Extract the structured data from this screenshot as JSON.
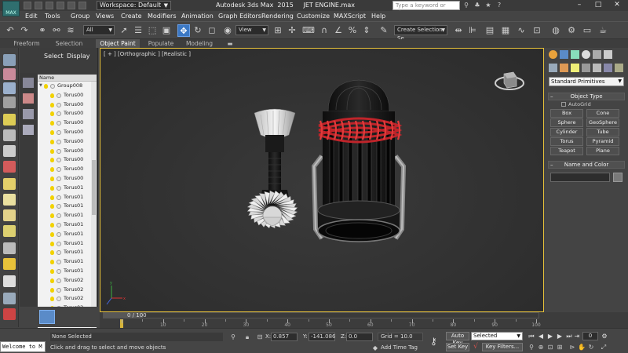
{
  "app": {
    "title": "Autodesk 3ds Max  2015     JET ENGINE.max",
    "icon_label": "MAX",
    "workspace": "Workspace: Default",
    "search_placeholder": "Type a keyword or phrase"
  },
  "menubar": [
    "Edit",
    "Tools",
    "Group",
    "Views",
    "Create",
    "Modifiers",
    "Animation",
    "Graph Editors",
    "Rendering",
    "Customize",
    "MAXScript",
    "Help"
  ],
  "toolbar": {
    "selection_filter": "All",
    "ref_coord": "View",
    "named_selection": "Create Selection Se",
    "icons": [
      "undo-icon",
      "redo-icon",
      "select-link-icon",
      "unlink-icon",
      "bind-space-warp-icon",
      "select-object-icon",
      "select-by-name-icon",
      "rect-selection-icon",
      "window-crossing-icon",
      "select-move-icon",
      "select-rotate-icon",
      "select-scale-icon",
      "pivot-icon",
      "select-manipulate-icon",
      "keyboard-shortcut-icon",
      "snap-icon",
      "angle-snap-icon",
      "percent-snap-icon",
      "spinner-snap-icon",
      "edit-named-selection-icon",
      "mirror-icon",
      "align-icon",
      "layer-explorer-icon",
      "scene-explorer-icon",
      "curve-editor-icon",
      "schematic-view-icon",
      "material-editor-icon",
      "render-setup-icon",
      "rendered-frame-icon",
      "render-icon"
    ]
  },
  "ribbon_tabs": [
    "Freeform",
    "Selection",
    "Object Paint",
    "Populate",
    "Modeling"
  ],
  "ribbon_active": "Object Paint",
  "explorer": {
    "tabs": [
      "Select",
      "Display"
    ],
    "column_header": "Name",
    "group_name": "Group008",
    "items": [
      "Torus00",
      "Torus00",
      "Torus00",
      "Torus00",
      "Torus00",
      "Torus00",
      "Torus00",
      "Torus00",
      "Torus00",
      "Torus00",
      "Torus01",
      "Torus01",
      "Torus01",
      "Torus01",
      "Torus01",
      "Torus01",
      "Torus01",
      "Torus01",
      "Torus01",
      "Torus01",
      "Torus02",
      "Torus02",
      "Torus02",
      "Torus02"
    ]
  },
  "viewport": {
    "label": "[ + ] [Orthographic ] [Realistic ]"
  },
  "command_panel": {
    "category": "Standard Primitives",
    "rollout_object_type": "Object Type",
    "rollout_name_color": "Name and Color",
    "autogrid_label": "AutoGrid",
    "buttons": [
      "Box",
      "Cone",
      "Sphere",
      "GeoSphere",
      "Cylinder",
      "Tube",
      "Torus",
      "Pyramid",
      "Teapot",
      "Plane"
    ],
    "object_color": "#7a7a7a"
  },
  "timeline": {
    "slider_label": "0 / 100",
    "ticks": [
      10,
      20,
      30,
      40,
      50,
      60,
      70,
      80,
      90,
      100
    ]
  },
  "status": {
    "maxscript_text": "Welcome to M",
    "selection_text": "None Selected",
    "prompt": "Click and drag to select and move objects",
    "x_label": "X:",
    "x_value": "0.857",
    "y_label": "Y:",
    "y_value": "-141.086",
    "z_label": "Z:",
    "z_value": "0.0",
    "grid": "Grid = 10.0",
    "add_time_tag": "Add Time Tag",
    "auto_key": "Auto Key",
    "set_key": "Set Key",
    "key_mode": "Selected",
    "key_filters": "Key Filters...",
    "current_frame": "0"
  },
  "colors": {
    "viewport_border": "#e8c23a",
    "active_blue": "#3b78c4",
    "accent_red": "#c0242a"
  }
}
